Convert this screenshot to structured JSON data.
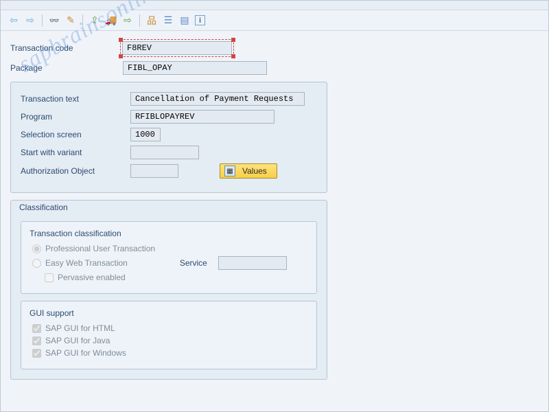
{
  "header_fields": {
    "tcode_label": "Transaction code",
    "tcode_value": "F8REV",
    "package_label": "Package",
    "package_value": "FIBL_OPAY"
  },
  "details": {
    "text_label": "Transaction text",
    "text_value": "Cancellation of Payment Requests",
    "program_label": "Program",
    "program_value": "RFIBLOPAYREV",
    "selscreen_label": "Selection screen",
    "selscreen_value": "1000",
    "variant_label": "Start with variant",
    "variant_value": "",
    "authobj_label": "Authorization Object",
    "authobj_value": "",
    "values_btn": "Values"
  },
  "classification": {
    "group_title": "Classification",
    "subgroup_title": "Transaction classification",
    "radio_professional": "Professional User Transaction",
    "radio_easyweb": "Easy Web Transaction",
    "service_label": "Service",
    "service_value": "",
    "chk_pervasive": "Pervasive enabled",
    "gui_title": "GUI support",
    "gui_html": "SAP GUI for HTML",
    "gui_java": "SAP GUI for Java",
    "gui_win": "SAP GUI for Windows"
  },
  "watermark": "sapbrainsonline.com"
}
